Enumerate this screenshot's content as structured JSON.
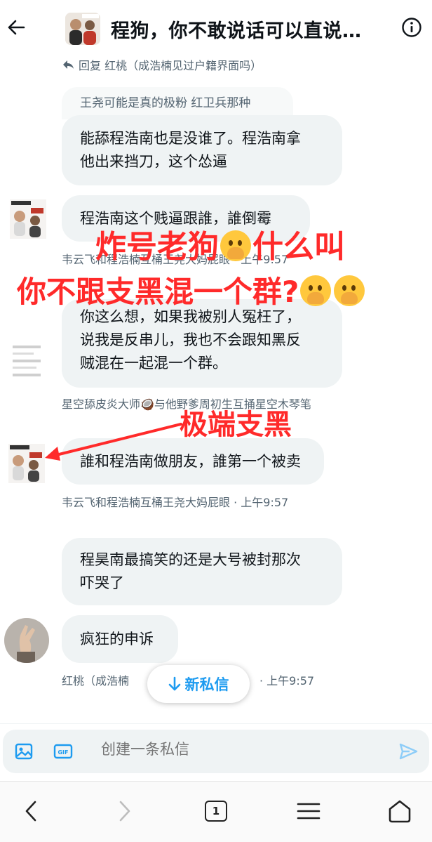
{
  "header": {
    "title": "程狗，你不敢说话可以直说…"
  },
  "reply": {
    "text": "回复 红桃（成浩楠见过户籍界面吗）"
  },
  "messages": [
    {
      "quote": "王尧可能是真的极粉 红卫兵那种",
      "lines": [
        "能舔程浩南也是没谁了。程浩南拿",
        "他出来挡刀，这个怂逼"
      ]
    },
    {
      "lines": [
        "程浩南这个贱逼跟誰，誰倒霉"
      ],
      "meta": "韦云飞和程浩楠互桶王尧大妈屁眼 · 上午9:57"
    },
    {
      "lines": [
        "你这么想，如果我被别人冤枉了，",
        "说我是反串儿，我也不会跟知黑反",
        "贼混在一起混一个群。"
      ],
      "meta": "星空舔皮炎大师🥥与他野爹周初生互捅星空木琴笔"
    },
    {
      "lines": [
        "誰和程浩南做朋友，誰第一个被卖"
      ],
      "meta": "韦云飞和程浩楠互桶王尧大妈屁眼 · 上午9:57"
    },
    {
      "lines": [
        "程昊南最搞笑的还是大号被封那次",
        "吓哭了"
      ]
    },
    {
      "lines": [
        "疯狂的申诉"
      ],
      "meta_left": "红桃（成浩楠",
      "meta_right": "· 上午9:57"
    }
  ],
  "annotations": {
    "line1": "炸号老狗",
    "line1b": "什么叫",
    "line2": "你不跟支黑混一个群?",
    "arrow_label": "极端支黑",
    "color": "#ff2a2a"
  },
  "new_messages_label": "新私信",
  "composer": {
    "placeholder": "创建一条私信",
    "gif_label": "GIF"
  },
  "browser": {
    "tab_count": "1"
  },
  "colors": {
    "accent": "#1d9bf0",
    "bubble": "#eff3f4",
    "muted": "#536471"
  }
}
